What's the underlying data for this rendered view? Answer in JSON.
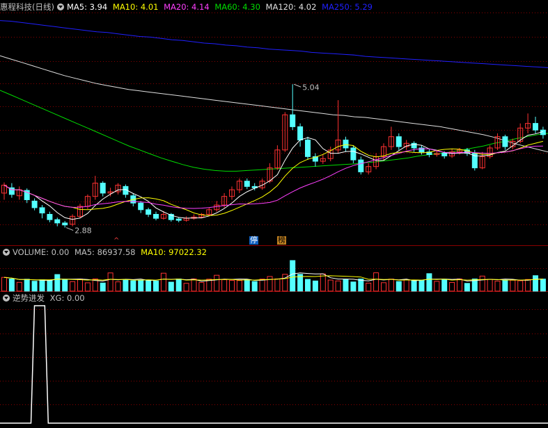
{
  "colors": {
    "bg": "#000000",
    "up": "#ff3232",
    "down": "#54ffff",
    "grid": "#8b0000",
    "ma5": "#ffffff",
    "ma10": "#ffff00",
    "ma20": "#ff40ff",
    "ma60": "#00dd00",
    "ma120": "#e0e0e0",
    "ma250": "#2020ff",
    "text": "#c0c0c0"
  },
  "legend_main": {
    "title": "惠程科技(日线)",
    "ma5": "MA5: 3.94",
    "ma10": "MA10: 4.01",
    "ma20": "MA20: 4.14",
    "ma60": "MA60: 4.30",
    "ma120": "MA120: 4.02",
    "ma250": "MA250: 5.29"
  },
  "legend_volume": {
    "title": "VOLUME: 0.00",
    "ma5": "MA5: 86937.58",
    "ma10": "MA10: 97022.32"
  },
  "legend_indicator": {
    "title": "逆势进发",
    "xg": "XG: 0.00"
  },
  "markers": {
    "stop": "停",
    "list": "榜",
    "arrow": "^"
  },
  "chart_data": [
    {
      "type": "candlestick",
      "title": "惠程科技(日线)",
      "annotations": [
        {
          "label": "5.04",
          "value": 5.04
        },
        {
          "label": "2.88",
          "value": 2.88
        }
      ],
      "ylim": [
        2.75,
        6.1
      ],
      "series": [
        {
          "name": "MA250",
          "final": 5.29,
          "values": [
            6.0,
            5.99,
            5.97,
            5.95,
            5.93,
            5.91,
            5.89,
            5.87,
            5.85,
            5.83,
            5.82,
            5.8,
            5.78,
            5.76,
            5.75,
            5.73,
            5.71,
            5.7,
            5.68,
            5.66,
            5.65,
            5.63,
            5.62,
            5.6,
            5.59,
            5.57,
            5.56,
            5.55,
            5.54,
            5.52,
            5.51,
            5.5,
            5.49,
            5.48,
            5.46,
            5.45,
            5.44,
            5.43,
            5.42,
            5.41,
            5.4,
            5.39,
            5.38,
            5.37,
            5.36,
            5.35,
            5.34,
            5.33,
            5.32,
            5.31,
            5.3,
            5.29
          ]
        },
        {
          "name": "MA120",
          "final": 4.02,
          "values": [
            5.47,
            5.42,
            5.37,
            5.32,
            5.27,
            5.22,
            5.17,
            5.13,
            5.09,
            5.05,
            5.02,
            4.99,
            4.96,
            4.94,
            4.92,
            4.9,
            4.88,
            4.86,
            4.84,
            4.82,
            4.8,
            4.78,
            4.76,
            4.74,
            4.72,
            4.7,
            4.68,
            4.66,
            4.64,
            4.62,
            4.6,
            4.58,
            4.57,
            4.55,
            4.54,
            4.52,
            4.5,
            4.48,
            4.46,
            4.44,
            4.42,
            4.4,
            4.37,
            4.34,
            4.31,
            4.28,
            4.24,
            4.19,
            4.14,
            4.1,
            4.06,
            4.02
          ]
        },
        {
          "name": "MA60",
          "final": 4.3,
          "values": [
            4.95,
            4.88,
            4.81,
            4.74,
            4.67,
            4.6,
            4.53,
            4.46,
            4.39,
            4.32,
            4.25,
            4.18,
            4.11,
            4.05,
            3.99,
            3.93,
            3.88,
            3.83,
            3.79,
            3.76,
            3.74,
            3.73,
            3.73,
            3.74,
            3.75,
            3.76,
            3.77,
            3.78,
            3.79,
            3.8,
            3.81,
            3.82,
            3.83,
            3.84,
            3.86,
            3.87,
            3.89,
            3.91,
            3.93,
            3.96,
            3.98,
            4.0,
            4.02,
            4.05,
            4.08,
            4.11,
            4.15,
            4.18,
            4.22,
            4.25,
            4.28,
            4.3
          ]
        }
      ]
    },
    {
      "type": "bar",
      "title": "VOLUME",
      "series": [
        {
          "name": "MA5",
          "final": 86937.58
        },
        {
          "name": "MA10",
          "final": 97022.32
        }
      ]
    },
    {
      "type": "line",
      "title": "逆势进发",
      "series": [
        {
          "name": "XG",
          "final": 0.0,
          "ylim": [
            0,
            1
          ],
          "values": [
            0,
            0,
            0,
            0,
            0,
            0,
            0,
            0,
            0,
            0,
            1,
            1,
            1,
            1,
            0,
            0,
            0,
            0,
            0,
            0,
            0,
            0,
            0,
            0,
            0,
            0,
            0,
            0,
            0,
            0,
            0,
            0,
            0,
            0,
            0,
            0,
            0,
            0,
            0,
            0,
            0,
            0,
            0,
            0,
            0,
            0,
            0,
            0,
            0,
            0,
            0,
            0,
            0,
            0,
            0,
            0,
            0,
            0,
            0,
            0,
            0,
            0,
            0,
            0,
            0,
            0,
            0,
            0,
            0,
            0,
            0,
            0,
            0,
            0,
            0,
            0,
            0,
            0,
            0,
            0,
            0,
            0,
            0,
            0,
            0,
            0,
            0,
            0,
            0,
            0,
            0,
            0,
            0,
            0,
            0,
            0,
            0,
            0,
            0,
            0,
            0,
            0,
            0,
            0,
            0,
            0,
            0,
            0,
            0,
            0,
            0,
            0,
            0,
            0,
            0,
            0,
            0,
            0,
            0,
            0,
            0,
            0,
            0,
            0,
            0,
            0,
            0,
            0,
            0,
            0,
            0,
            0,
            0,
            0,
            0,
            0,
            0,
            0,
            0,
            0,
            0,
            0,
            0,
            0,
            0,
            0,
            0,
            0,
            0,
            0,
            0,
            0,
            0,
            0,
            0,
            0,
            0,
            0,
            0,
            0
          ]
        }
      ]
    }
  ]
}
